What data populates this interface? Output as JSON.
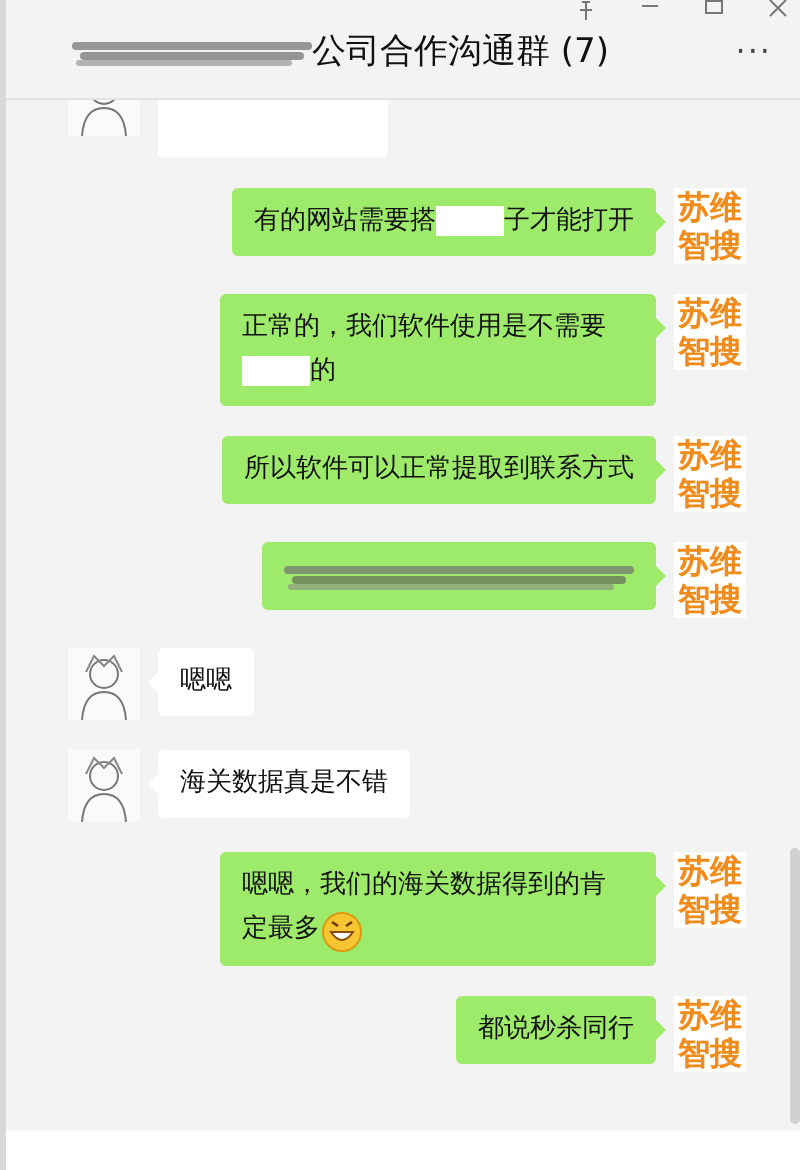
{
  "window": {
    "title": {
      "parts": [
        {
          "kind": "blurred"
        },
        {
          "kind": "text",
          "text": "公司合作沟通群 (7)"
        }
      ]
    },
    "menu": "···"
  },
  "messages": [
    {
      "kind": "incoming",
      "parts": [
        {
          "kind": "image"
        }
      ]
    },
    {
      "kind": "outgoing",
      "avatar": [
        "苏维",
        "智搜"
      ],
      "parts": [
        {
          "kind": "text",
          "text": "有的网站需要搭"
        },
        {
          "kind": "covered"
        },
        {
          "kind": "text",
          "text": "子才能打开"
        }
      ]
    },
    {
      "kind": "outgoing",
      "avatar": [
        "苏维",
        "智搜"
      ],
      "parts": [
        {
          "kind": "text",
          "text": "正常的，我们软件使用是不需要"
        },
        {
          "kind": "covered"
        },
        {
          "kind": "text",
          "text": "的"
        }
      ]
    },
    {
      "kind": "outgoing",
      "avatar": [
        "苏维",
        "智搜"
      ],
      "parts": [
        {
          "kind": "text",
          "text": "所以软件可以正常提取到联系方式"
        }
      ]
    },
    {
      "kind": "outgoing",
      "avatar": [
        "苏维",
        "智搜"
      ],
      "parts": [
        {
          "kind": "blurred"
        }
      ]
    },
    {
      "kind": "incoming",
      "parts": [
        {
          "kind": "text",
          "text": "嗯嗯"
        }
      ]
    },
    {
      "kind": "incoming",
      "parts": [
        {
          "kind": "text",
          "text": "海关数据真是不错"
        }
      ]
    },
    {
      "kind": "outgoing",
      "avatar": [
        "苏维",
        "智搜"
      ],
      "parts": [
        {
          "kind": "text",
          "text": "嗯嗯，我们的海关数据得到的肯"
        },
        {
          "kind": "text",
          "text": "定最多"
        },
        {
          "kind": "emoji"
        }
      ]
    },
    {
      "kind": "outgoing",
      "avatar": [
        "苏维",
        "智搜"
      ],
      "parts": [
        {
          "kind": "text",
          "text": "都说秒杀同行"
        }
      ]
    }
  ]
}
